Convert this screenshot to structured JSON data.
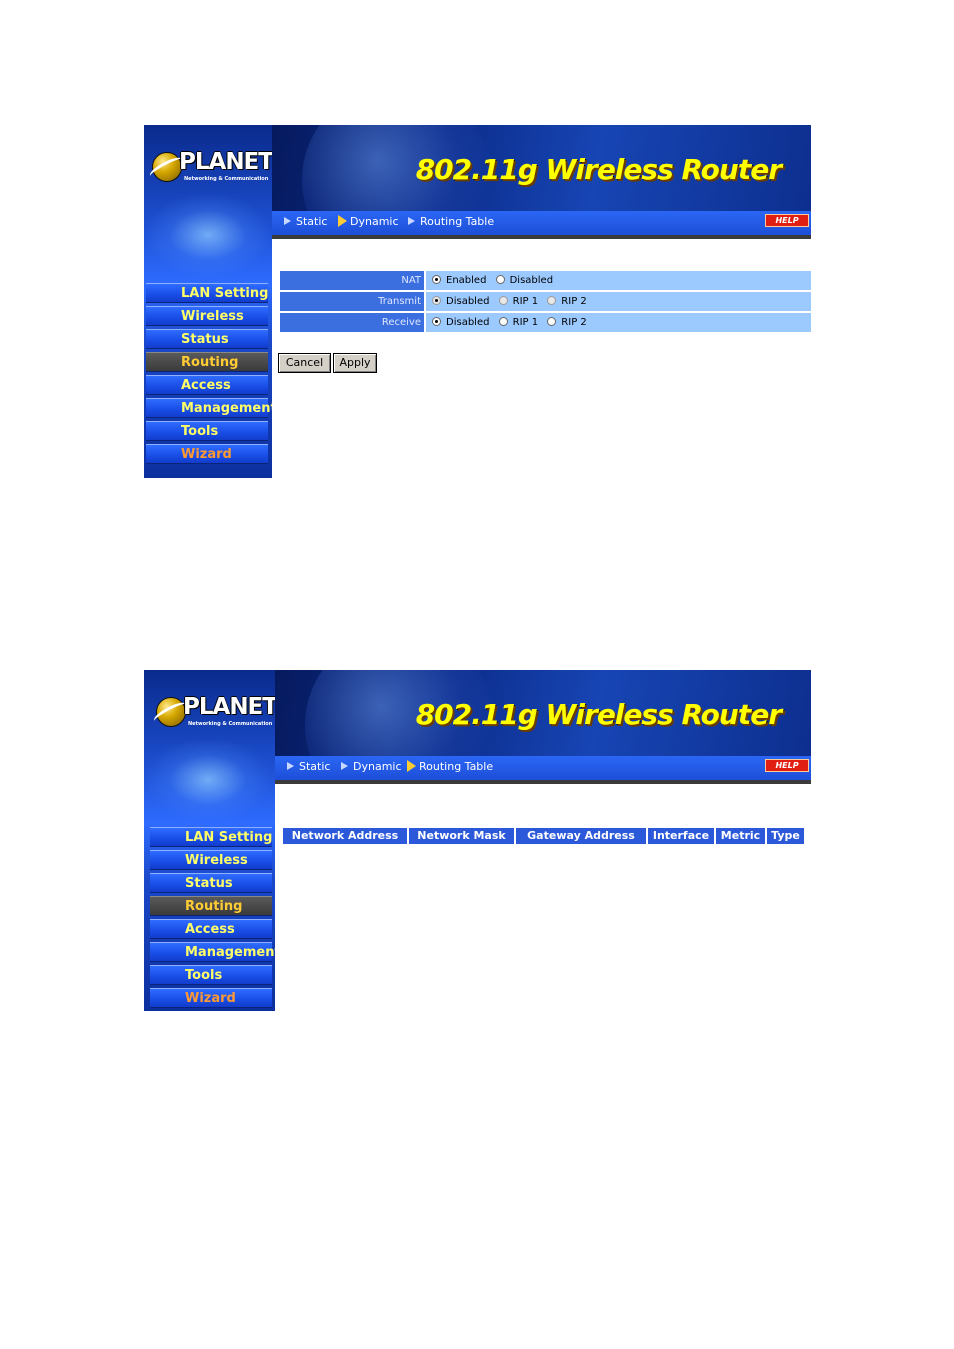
{
  "brand": {
    "name": "PLANET",
    "tagline": "Networking & Communication"
  },
  "banner": {
    "title": "802.11g Wireless Router",
    "help_label": "HELP"
  },
  "nav": {
    "items": [
      "LAN Setting",
      "Wireless",
      "Status",
      "Routing",
      "Access",
      "Management",
      "Tools",
      "Wizard"
    ],
    "active": "Routing"
  },
  "tabs": {
    "static": "Static",
    "dynamic": "Dynamic",
    "routing_table": "Routing Table"
  },
  "dynamic_routing": {
    "active_tab": "Dynamic",
    "rows": [
      {
        "label": "NAT",
        "options": [
          "Enabled",
          "Disabled"
        ],
        "selected": "Enabled"
      },
      {
        "label": "Transmit",
        "options": [
          "Disabled",
          "RIP 1",
          "RIP 2"
        ],
        "selected": "Disabled"
      },
      {
        "label": "Receive",
        "options": [
          "Disabled",
          "RIP 1",
          "RIP 2"
        ],
        "selected": "Disabled"
      }
    ],
    "cancel_label": "Cancel",
    "apply_label": "Apply"
  },
  "routing_table": {
    "active_tab": "Routing Table",
    "columns": [
      "Network Address",
      "Network Mask",
      "Gateway Address",
      "Interface",
      "Metric",
      "Type"
    ],
    "rows": []
  },
  "colors": {
    "nav_text": "#ffff66",
    "tab_bar": "#1d4fd8",
    "label_cell": "#3b6fe0",
    "value_cell": "#9ccaff",
    "help": "#e01e12"
  }
}
